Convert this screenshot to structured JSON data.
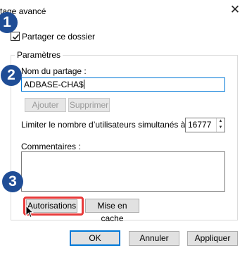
{
  "window": {
    "title": "tage avancé",
    "close_glyph": "✕"
  },
  "annotations": {
    "step1": "1",
    "step2": "2",
    "step3": "3"
  },
  "share_checkbox": {
    "label": "Partager ce dossier",
    "checked": true
  },
  "settings_group": {
    "legend": "Paramètres",
    "share_name_label": "Nom du partage :",
    "share_name_value": "ADBASE-CHA$",
    "add_button": "Ajouter",
    "remove_button": "Supprimer",
    "limit_label": "Limiter le nombre d’utilisateurs simultanés à :",
    "limit_value": "16777",
    "comments_label": "Commentaires :",
    "comments_value": "",
    "permissions_button": "Autorisations",
    "caching_button": "Mise en cache"
  },
  "footer": {
    "ok_button": "OK",
    "cancel_button": "Annuler",
    "apply_button": "Appliquer"
  },
  "colors": {
    "annotation_badge": "#1f4d96",
    "highlight_ring": "#e83a3a",
    "focus_blue": "#0078d7"
  },
  "icons": {
    "close": "close-icon",
    "checkmark": "checkmark-icon",
    "spin_up": "spin-up-icon",
    "spin_down": "spin-down-icon",
    "cursor": "mouse-cursor-icon"
  }
}
